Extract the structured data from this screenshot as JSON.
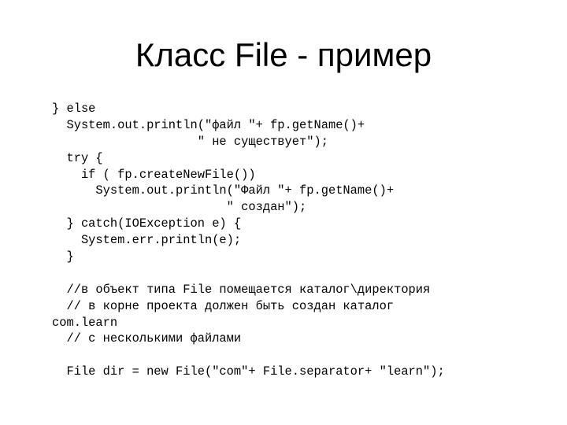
{
  "slide": {
    "title": "Класс File - пример",
    "code_lines": [
      "} else",
      "  System.out.println(\"файл \"+ fp.getName()+",
      "                    \" не существует\");",
      "  try {",
      "    if ( fp.createNewFile())",
      "      System.out.println(\"Файл \"+ fp.getName()+",
      "                        \" создан\");",
      "  } catch(IOException e) {",
      "    System.err.println(e);",
      "  }",
      "",
      "  //в объект типа File помещается каталог\\директория",
      "  // в корне проекта должен быть создан каталог",
      "com.learn",
      "  // с несколькими файлами",
      "",
      "  File dir = new File(\"com\"+ File.separator+ \"learn\");"
    ]
  }
}
